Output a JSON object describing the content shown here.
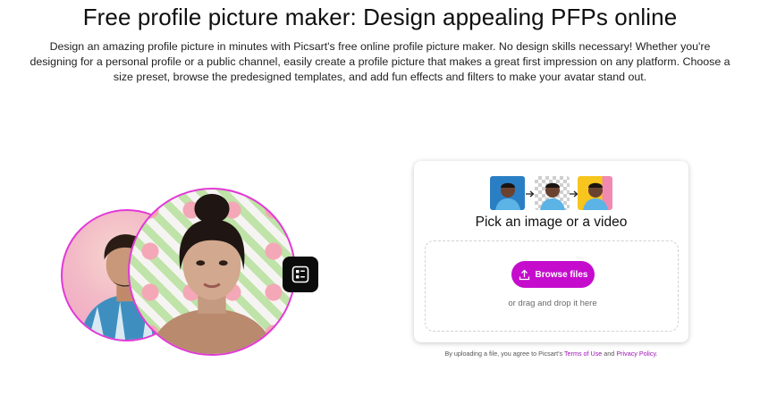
{
  "header": {
    "title": "Free profile picture maker: Design appealing PFPs online",
    "description": "Design an amazing profile picture in minutes with Picsart's free online profile picture maker. No design skills necessary! Whether you're designing for a personal profile or a public channel, easily create a profile picture that makes a great first impression on any platform. Choose a size preset, browse the predesigned templates, and add fun effects and filters to make your avatar stand out."
  },
  "illustration": {
    "back_photo_icon": "man-portrait",
    "front_photo_icon": "woman-portrait",
    "badge_icon": "template-grid-icon",
    "ring_color": "#e23ad7"
  },
  "upload": {
    "thumb_icons": [
      "original-photo",
      "background-removed",
      "new-background"
    ],
    "title": "Pick an image or a video",
    "browse_label": "Browse files",
    "drag_text": "or drag and drop it here",
    "accent_color": "#c50ccd"
  },
  "terms": {
    "prefix": "By uploading a file, you agree to Picsart's ",
    "terms_link": "Terms of Use",
    "middle": " and ",
    "privacy_link": "Privacy Policy",
    "suffix": "."
  }
}
